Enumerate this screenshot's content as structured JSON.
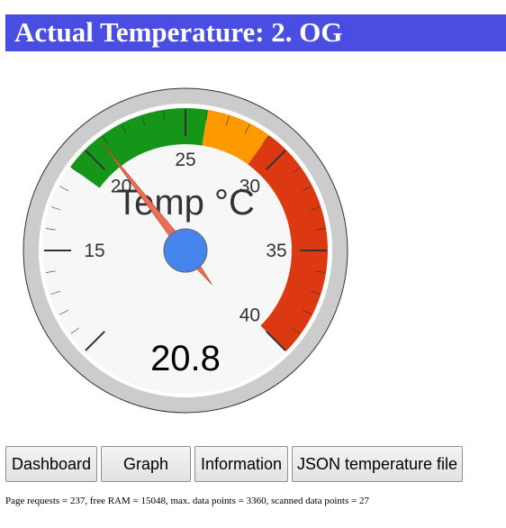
{
  "header": {
    "title": "Actual Temperature: 2. OG",
    "background_color": "#4a4de2"
  },
  "gauge": {
    "unit_label": "Temp °C",
    "value_display": "20.8",
    "value": 20.8,
    "min": 10,
    "max": 40,
    "tick_labels": [
      "15",
      "20",
      "25",
      "30",
      "35",
      "40"
    ],
    "bands": [
      {
        "from": 19,
        "to": 26,
        "color": "#169619"
      },
      {
        "from": 26,
        "to": 29,
        "color": "#ff9900"
      },
      {
        "from": 29,
        "to": 40,
        "color": "#dc3912"
      }
    ],
    "needle_color": "#e8705a",
    "hub_color": "#4684ee",
    "ring_color": "#cccccc",
    "face_color": "#f7f7f7"
  },
  "nav": {
    "dashboard_label": "Dashboard",
    "graph_label": "Graph",
    "information_label": "Information",
    "json_label": "JSON temperature file"
  },
  "footer": {
    "status": "Page requests = 237, free RAM = 15048, max. data points = 3360, scanned data points = 27"
  }
}
